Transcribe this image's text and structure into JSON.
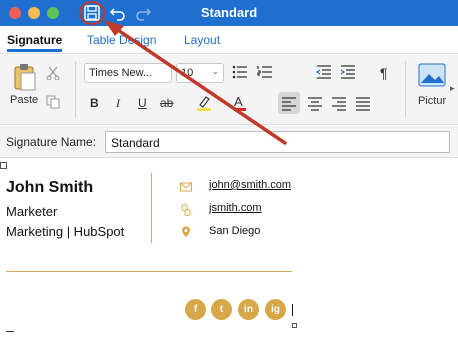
{
  "window": {
    "title": "Standard"
  },
  "tabs": [
    {
      "label": "Signature"
    },
    {
      "label": "Table Design"
    },
    {
      "label": "Layout"
    }
  ],
  "ribbon": {
    "paste_label": "Paste",
    "font_name": "Times New...",
    "font_size": "10",
    "bold": "B",
    "italic": "I",
    "underline": "U",
    "strike": "ab",
    "font_color_glyph": "A",
    "pilcrow": "¶",
    "picture_label": "Pictur"
  },
  "signature_name": {
    "label": "Signature Name:",
    "value": "Standard"
  },
  "signature": {
    "name": "John Smith",
    "title": "Marketer",
    "company": "Marketing | HubSpot",
    "email": "john@smith.com",
    "website": "jsmith.com",
    "location": "San Diego",
    "social": [
      "f",
      "t",
      "in",
      "ig"
    ]
  },
  "colors": {
    "titlebar": "#1f6fd0",
    "accent": "#d7a749",
    "annotation": "#c0392b"
  }
}
